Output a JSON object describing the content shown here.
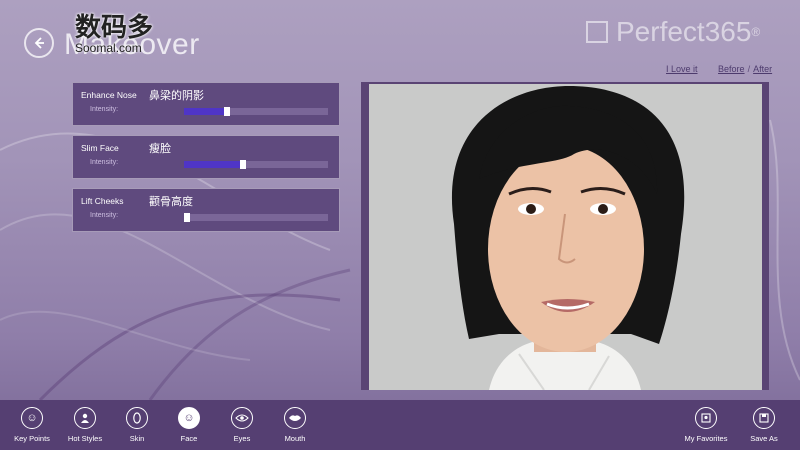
{
  "header": {
    "title": "Makeover",
    "brand": "Perfect365",
    "brand_mark": "®",
    "watermark_cn": "数码多",
    "watermark_en": "Soomal.com"
  },
  "links": {
    "love": "I Love it",
    "before": "Before",
    "separator": "/",
    "after": "After"
  },
  "panels": [
    {
      "label": "Enhance Nose",
      "cn": "鼻梁的阴影",
      "intensity_label": "Intensity:",
      "value": 0.3
    },
    {
      "label": "Slim Face",
      "cn": "瘦脸",
      "intensity_label": "Intensity:",
      "value": 0.41
    },
    {
      "label": "Lift Cheeks",
      "cn": "颧骨高度",
      "intensity_label": "Intensity:",
      "value": 0.02
    }
  ],
  "appbar": {
    "key_points": "Key Points",
    "hot_styles": "Hot Styles",
    "skin": "Skin",
    "face": "Face",
    "eyes": "Eyes",
    "mouth": "Mouth",
    "my_favorites": "My Favorites",
    "save_as": "Save As"
  },
  "colors": {
    "panel_bg": "#5f4a7e",
    "slider_fill": "#4f35c7",
    "appbar_bg": "#553f72"
  }
}
